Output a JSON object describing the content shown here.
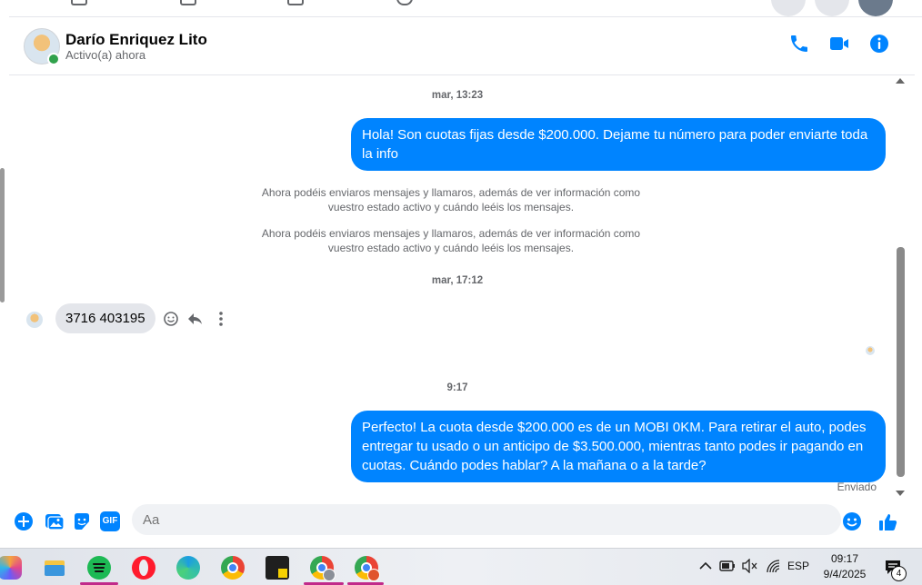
{
  "contact": {
    "name": "Darío Enriquez Lito",
    "status": "Activo(a) ahora"
  },
  "messages": {
    "timestamp_1": "mar, 13:23",
    "outgoing_1": "Hola! Son cuotas fijas desde $200.000. Dejame tu número para poder enviarte toda la info",
    "system_1": "Ahora podéis enviaros mensajes y llamaros, además de ver información como vuestro estado activo y cuándo leéis los mensajes.",
    "system_2": "Ahora podéis enviaros mensajes y llamaros, además de ver información como vuestro estado activo y cuándo leéis los mensajes.",
    "timestamp_2": "mar, 17:12",
    "incoming_1": "3716 403195",
    "timestamp_3": "9:17",
    "outgoing_2": "Perfecto! La cuota desde $200.000 es de un MOBI 0KM. Para retirar el auto, podes entregar tu usado o un anticipo de $3.500.000, mientras tanto podes ir pagando en cuotas. Cuándo podes hablar? A la mañana o a la tarde?",
    "sent_status": "Enviado"
  },
  "composer": {
    "placeholder": "Aa",
    "gif_label": "GIF"
  },
  "taskbar": {
    "language": "ESP",
    "time": "09:17",
    "date": "9/4/2025",
    "notification_count": "4"
  },
  "colors": {
    "accent": "#0084ff",
    "online": "#31a24c",
    "incoming_bubble": "#e4e6eb"
  },
  "icons": {
    "header": [
      "phone-icon",
      "video-icon",
      "info-icon"
    ],
    "composer": [
      "plus-icon",
      "image-icon",
      "sticker-icon",
      "gif-icon",
      "emoji-icon",
      "like-icon"
    ],
    "message_actions": [
      "react-icon",
      "reply-icon",
      "more-icon"
    ],
    "taskbar_apps": [
      "copilot",
      "file-explorer",
      "spotify",
      "opera",
      "edge",
      "chrome",
      "sticky-notes",
      "chrome-profile-y",
      "chrome-profile-r"
    ]
  }
}
